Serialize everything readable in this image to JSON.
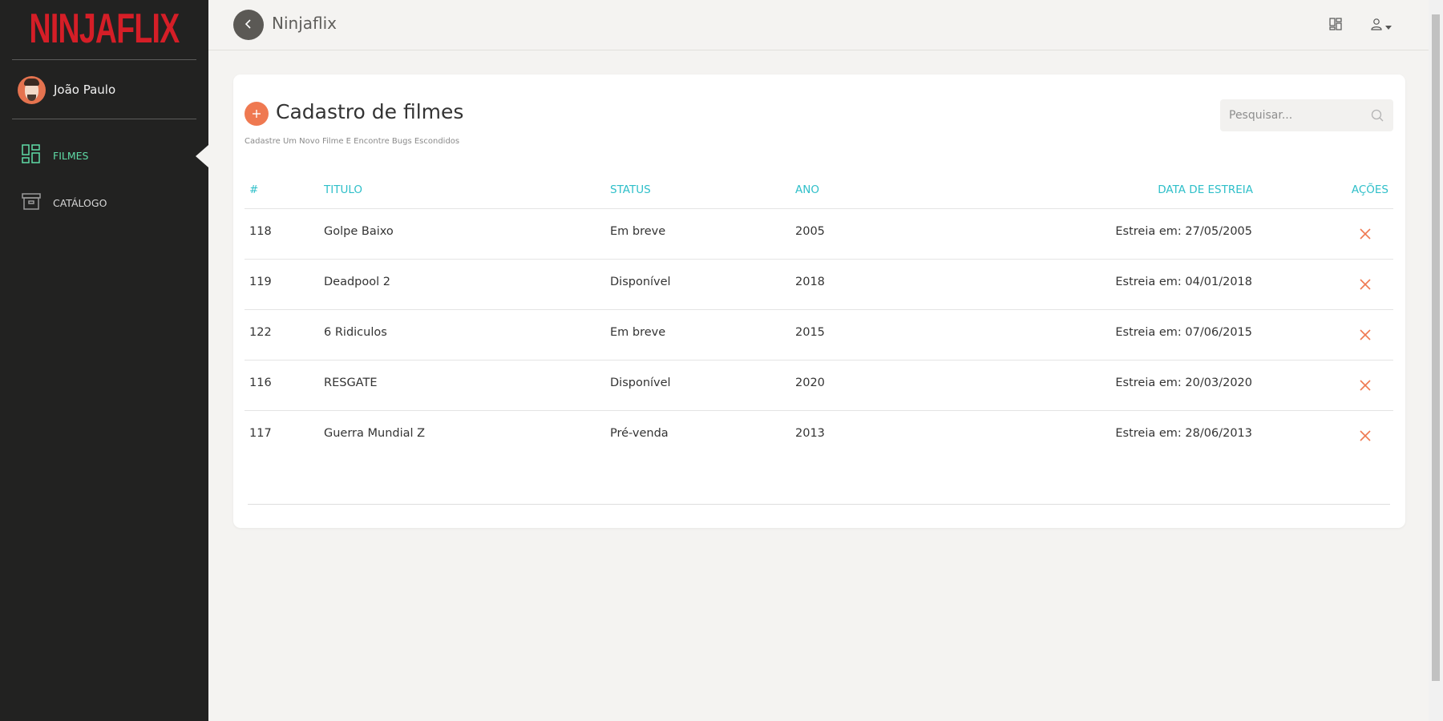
{
  "brand": {
    "logo_text": "NINJAFLIX",
    "color": "#d51e27"
  },
  "sidebar": {
    "user": {
      "name": "João Paulo"
    },
    "items": [
      {
        "label": "FILMES",
        "icon": "dashboard-icon",
        "active": true
      },
      {
        "label": "CATÁLOGO",
        "icon": "archive-icon",
        "active": false
      }
    ],
    "active_color": "#5fdca7"
  },
  "header": {
    "title": "Ninjaflix",
    "icons": [
      "back-icon",
      "grid-icon",
      "user-icon",
      "caret-down-icon"
    ]
  },
  "page": {
    "title": "Cadastro de filmes",
    "subtitle": "Cadastre Um Novo Filme E Encontre Bugs Escondidos",
    "search": {
      "placeholder": "Pesquisar...",
      "value": ""
    },
    "accent_color": "#ef7951"
  },
  "table": {
    "header_color": "#2ebfc9",
    "columns": [
      "#",
      "TITULO",
      "STATUS",
      "ANO",
      "DATA DE ESTREIA",
      "AÇÕES"
    ],
    "rows": [
      {
        "id": "118",
        "title": "Golpe Baixo",
        "status": "Em breve",
        "year": "2005",
        "release": "Estreia em: 27/05/2005"
      },
      {
        "id": "119",
        "title": "Deadpool 2",
        "status": "Disponível",
        "year": "2018",
        "release": "Estreia em: 04/01/2018"
      },
      {
        "id": "122",
        "title": "6 Ridiculos",
        "status": "Em breve",
        "year": "2015",
        "release": "Estreia em: 07/06/2015"
      },
      {
        "id": "116",
        "title": "RESGATE",
        "status": "Disponível",
        "year": "2020",
        "release": "Estreia em: 20/03/2020"
      },
      {
        "id": "117",
        "title": "Guerra Mundial Z",
        "status": "Pré-venda",
        "year": "2013",
        "release": "Estreia em: 28/06/2013"
      }
    ]
  }
}
